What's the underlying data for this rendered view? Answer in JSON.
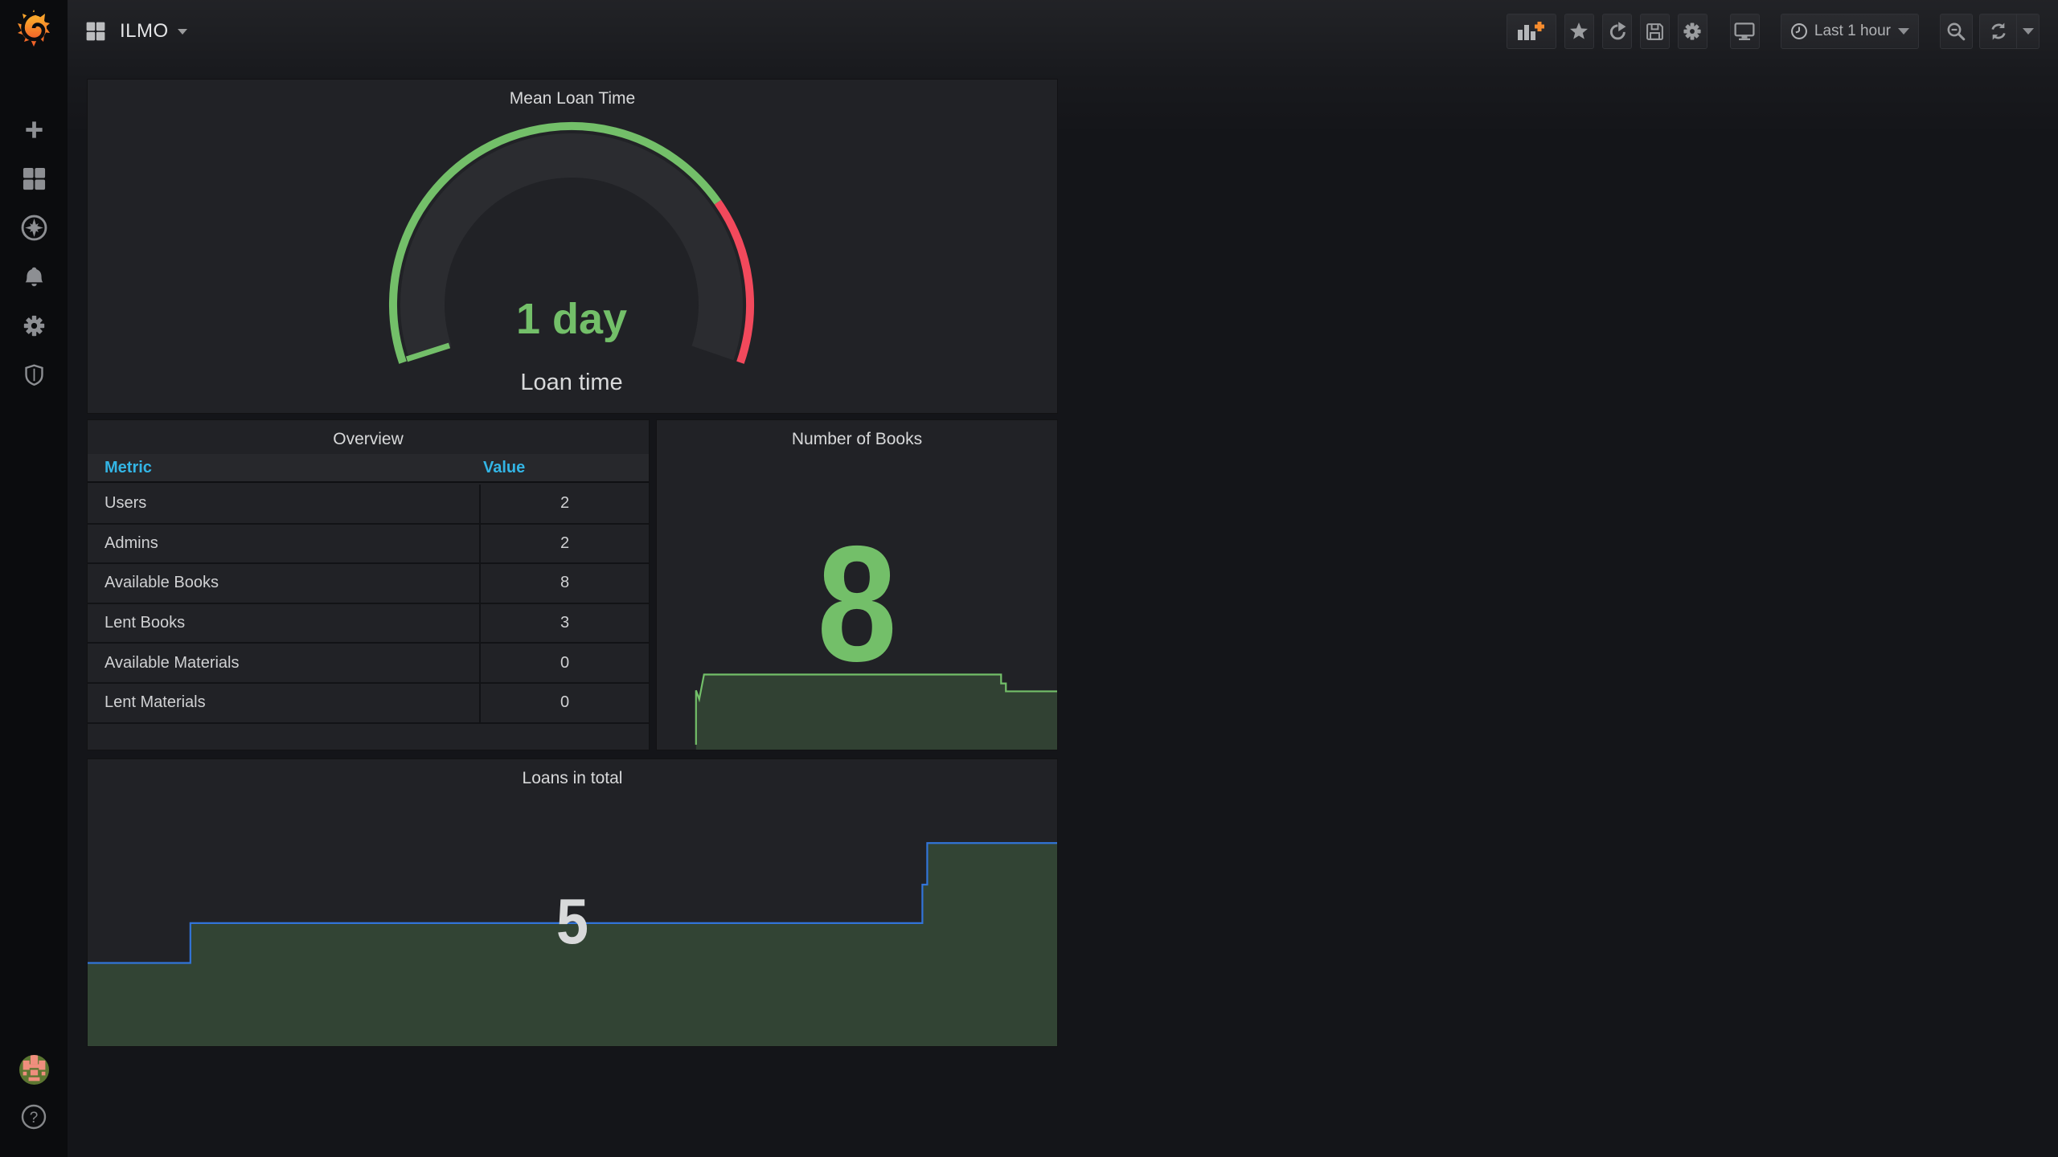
{
  "navbar": {
    "title": "ILMO",
    "time_range": "Last 1 hour"
  },
  "sidebar": {
    "items": [
      "create",
      "dashboards",
      "explore",
      "alerting",
      "configuration",
      "server-admin"
    ]
  },
  "toolbar": {
    "buttons": [
      "add-panel",
      "star",
      "share",
      "save",
      "settings",
      "cycle-view",
      "time-range",
      "zoom-out",
      "refresh",
      "refresh-interval"
    ]
  },
  "panels": {
    "mean_loan_time": {
      "title": "Mean Loan Time",
      "value_text": "1 day",
      "label": "Loan time"
    },
    "overview": {
      "title": "Overview",
      "columns": [
        "Metric",
        "Value"
      ],
      "rows": [
        [
          "Users",
          "2"
        ],
        [
          "Admins",
          "2"
        ],
        [
          "Available Books",
          "8"
        ],
        [
          "Lent Books",
          "3"
        ],
        [
          "Available Materials",
          "0"
        ],
        [
          "Lent Materials",
          "0"
        ]
      ]
    },
    "number_of_books": {
      "title": "Number of Books",
      "value": "8"
    },
    "loans_in_total": {
      "title": "Loans in total",
      "value": "5"
    }
  },
  "colors": {
    "green": "#73BF69",
    "red": "#F2495C",
    "table_header_blue": "#33B5E5",
    "spark_blue": "#3274D9",
    "value_gray": "#d8d9da"
  },
  "chart_data": [
    {
      "panel": "mean_loan_time",
      "type": "gauge",
      "value": 1,
      "unit": "day",
      "display": "1 day",
      "label": "Loan time",
      "green_frac": 0.75,
      "red_frac": 0.25
    },
    {
      "panel": "number_of_books",
      "type": "area",
      "current": 8,
      "values_approx": [
        4,
        8,
        8,
        8,
        8,
        8,
        8,
        7,
        7
      ],
      "line_color": "#73BF69",
      "fill_color": "rgba(115,191,105,0.20)",
      "line_points": [
        [
          0.098,
          0.985
        ],
        [
          0.098,
          0.82
        ],
        [
          0.106,
          0.847
        ],
        [
          0.118,
          0.772
        ],
        [
          0.86,
          0.772
        ],
        [
          0.86,
          0.799
        ],
        [
          0.872,
          0.799
        ],
        [
          0.872,
          0.823
        ],
        [
          1.0,
          0.823
        ]
      ]
    },
    {
      "panel": "loans_in_total",
      "type": "area",
      "current": 5,
      "values_approx": [
        2,
        3,
        3,
        3,
        3,
        3,
        3,
        4,
        5,
        5
      ],
      "line_color": "#3274D9",
      "fill_color": "rgba(115,191,105,0.22)",
      "line_points": [
        [
          0,
          0.71
        ],
        [
          0.106,
          0.71
        ],
        [
          0.106,
          0.571
        ],
        [
          0.861,
          0.571
        ],
        [
          0.861,
          0.437
        ],
        [
          0.866,
          0.437
        ],
        [
          0.866,
          0.292
        ],
        [
          1.0,
          0.292
        ]
      ]
    }
  ]
}
